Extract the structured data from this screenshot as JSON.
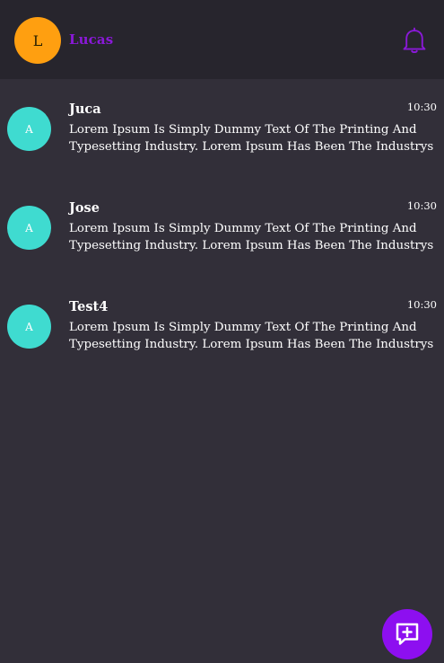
{
  "header": {
    "avatar_initial": "L",
    "user_name": "Lucas",
    "notification_icon": "bell-icon"
  },
  "chats": [
    {
      "avatar_initial": "A",
      "name": "Juca",
      "time": "10:30",
      "message_line1": "Lorem Ipsum Is Simply Dummy Text Of The Printing And",
      "message_line2": "Typesetting Industry. Lorem Ipsum Has Been The Industrys"
    },
    {
      "avatar_initial": "A",
      "name": "Jose",
      "time": "10:30",
      "message_line1": "Lorem Ipsum Is Simply Dummy Text Of The Printing And",
      "message_line2": "Typesetting Industry. Lorem Ipsum Has Been The Industrys"
    },
    {
      "avatar_initial": "A",
      "name": "Test4",
      "time": "10:30",
      "message_line1": "Lorem Ipsum Is Simply Dummy Text Of The Printing And",
      "message_line2": "Typesetting Industry. Lorem Ipsum Has Been The Industrys"
    }
  ],
  "fab": {
    "icon": "new-chat-icon"
  },
  "colors": {
    "background": "#322f39",
    "header_background": "#27252d",
    "accent_purple": "#8d0ff0",
    "user_avatar": "#ff9f10",
    "chat_avatar": "#3fdbd0"
  }
}
